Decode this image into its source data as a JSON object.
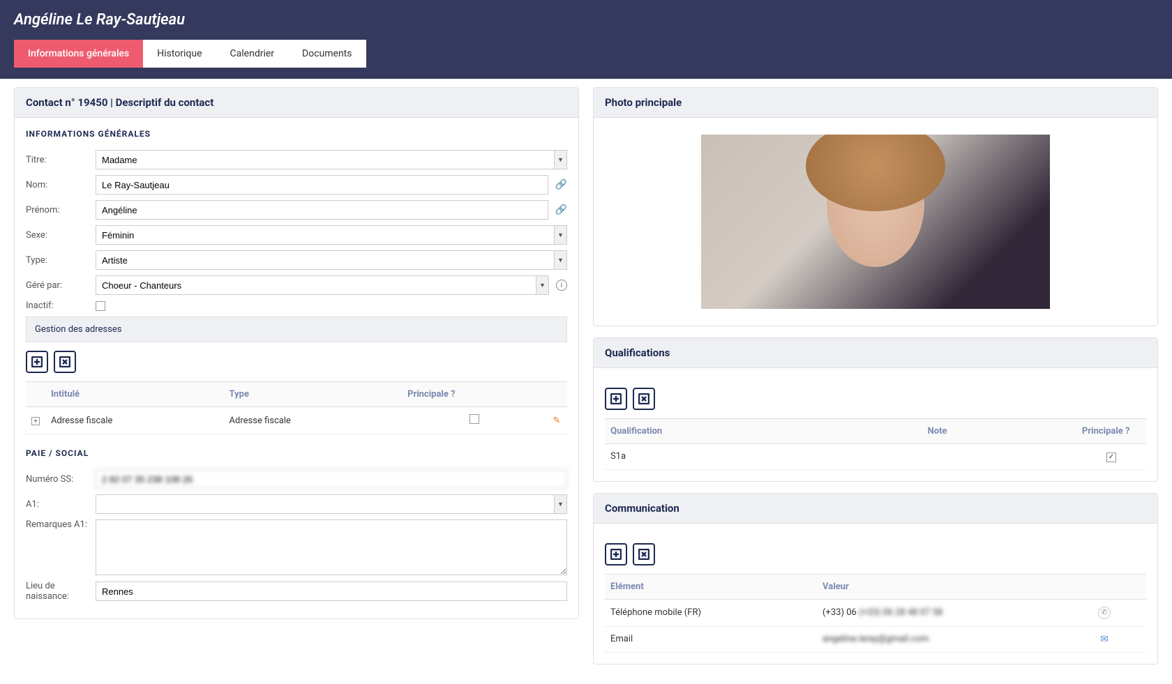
{
  "header": {
    "title": "Angéline Le Ray-Sautjeau",
    "tabs": [
      {
        "label": "Informations générales",
        "active": true
      },
      {
        "label": "Historique",
        "active": false
      },
      {
        "label": "Calendrier",
        "active": false
      },
      {
        "label": "Documents",
        "active": false
      }
    ]
  },
  "contactPanel": {
    "title": "Contact n° 19450 | Descriptif du contact",
    "sectionLabel": "INFORMATIONS GÉNÉRALES",
    "fields": {
      "titre": {
        "label": "Titre:",
        "value": "Madame"
      },
      "nom": {
        "label": "Nom:",
        "value": "Le Ray-Sautjeau"
      },
      "prenom": {
        "label": "Prénom:",
        "value": "Angéline"
      },
      "sexe": {
        "label": "Sexe:",
        "value": "Féminin"
      },
      "type": {
        "label": "Type:",
        "value": "Artiste"
      },
      "gerePar": {
        "label": "Géré par:",
        "value": "Choeur - Chanteurs"
      },
      "inactif": {
        "label": "Inactif:",
        "checked": false
      }
    }
  },
  "addresses": {
    "title": "Gestion des adresses",
    "columns": {
      "intitule": "Intitulé",
      "type": "Type",
      "principale": "Principale ?"
    },
    "rows": [
      {
        "intitule": "Adresse fiscale",
        "type": "Adresse fiscale",
        "principale": false
      }
    ]
  },
  "paie": {
    "sectionLabel": "PAIE / SOCIAL",
    "fields": {
      "numeroSS": {
        "label": "Numéro SS:",
        "value": "2 82 07 35 238 108 26"
      },
      "a1": {
        "label": "A1:",
        "value": ""
      },
      "remarquesA1": {
        "label": "Remarques A1:",
        "value": ""
      },
      "lieuNaissance": {
        "label": "Lieu de naissance:",
        "value": "Rennes"
      }
    }
  },
  "photoPanel": {
    "title": "Photo principale"
  },
  "qualifications": {
    "title": "Qualifications",
    "columns": {
      "qualification": "Qualification",
      "note": "Note",
      "principale": "Principale ?"
    },
    "rows": [
      {
        "qualification": "S1a",
        "note": "",
        "principale": true
      }
    ]
  },
  "communication": {
    "title": "Communication",
    "columns": {
      "element": "Elément",
      "valeur": "Valeur"
    },
    "rows": [
      {
        "element": "Téléphone mobile (FR)",
        "valeur": "(+33) 06 28 48 07 58",
        "icon": "phone"
      },
      {
        "element": "Email",
        "valeur": "angeline.leray@gmail.com",
        "icon": "mail"
      }
    ]
  }
}
